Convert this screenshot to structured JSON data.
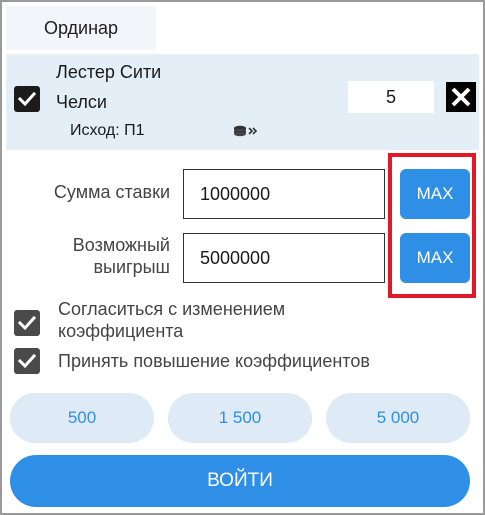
{
  "tab": {
    "label": "Ординар"
  },
  "bet": {
    "team1": "Лестер Сити",
    "team2": "Челси",
    "outcome": "Исход: П1",
    "coefficient": "5",
    "selected": true
  },
  "stake": {
    "label": "Сумма ставки",
    "value": "1000000",
    "max_label": "MAX"
  },
  "win": {
    "label_line1": "Возможный",
    "label_line2": "выигрыш",
    "value": "5000000",
    "max_label": "MAX"
  },
  "options": [
    {
      "line1": "Согласиться с изменением",
      "line2": "коэффициента",
      "checked": true
    },
    {
      "line1": "Принять повышение коэффициентов",
      "checked": true
    }
  ],
  "quick_amounts": [
    "500",
    "1 500",
    "5 000"
  ],
  "login_label": "ВОЙТИ",
  "colors": {
    "accent": "#2f8fe6",
    "highlight": "#e11926",
    "bet_bg": "#e4eef6",
    "quick_bg": "#deeaf5"
  },
  "icons": {
    "bet_check": "checkmark-icon",
    "close": "close-icon",
    "coins": "coins-icon"
  }
}
